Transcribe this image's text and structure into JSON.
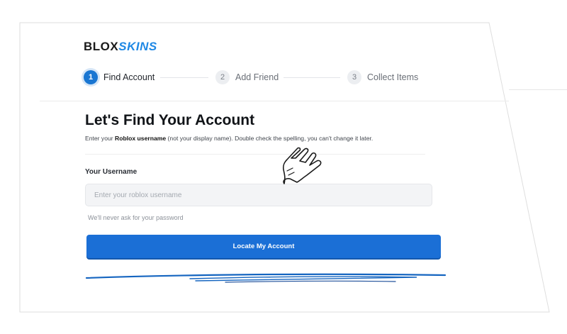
{
  "brand": {
    "part1": "BLOX",
    "part2": "SKINS"
  },
  "steps": [
    {
      "number": "1",
      "label": "Find Account",
      "active": true
    },
    {
      "number": "2",
      "label": "Add Friend",
      "active": false
    },
    {
      "number": "3",
      "label": "Collect Items",
      "active": false
    }
  ],
  "heading": "Let's Find Your Account",
  "subtitle": {
    "prefix": "Enter your ",
    "bold": "Roblox username",
    "suffix": " (not your display name). Double check the spelling, you can't change it later."
  },
  "username_field": {
    "label": "Your Username",
    "placeholder": "Enter your roblox username",
    "value": "",
    "helper": "We'll never ask for your password"
  },
  "submit_button": {
    "label": "Locate My Account"
  },
  "colors": {
    "accent": "#1b6fd6",
    "step_active": "#1976d2",
    "scribble": "#1565c0"
  },
  "icons": {
    "pointer": "pointing-hand-icon",
    "scribble": "pen-scribble-mark"
  }
}
